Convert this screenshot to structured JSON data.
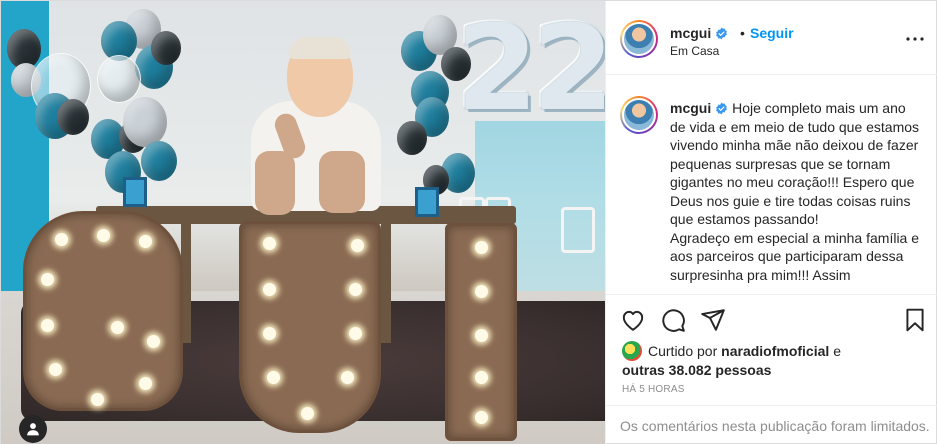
{
  "post": {
    "username": "mcgui",
    "follow_label": "Seguir",
    "separator": "•",
    "location": "Em Casa",
    "photo_number_text": "22",
    "caption": "Hoje completo mais um ano de vida e em meio de tudo que estamos vivendo minha mãe não deixou de fazer pequenas surpresas que se tornam gigantes no meu coração!!! Espero que Deus nos guie e tire todas coisas ruins que estamos passando!\nAgradeço em especial a minha família e aos parceiros que participaram dessa surpresinha pra mim!!! Assim",
    "likes_prefix": "Curtido por",
    "likes_user": "naradiofmoficial",
    "likes_and": "e",
    "likes_others": "outras 38.082 pessoas",
    "time_ago": "HÁ 5 HORAS",
    "comments_limited": "Os comentários nesta publicação foram limitados."
  },
  "icons": [
    "verified-badge-icon",
    "more-options-icon",
    "heart-icon",
    "comment-icon",
    "share-icon",
    "bookmark-icon",
    "tag-user-icon"
  ],
  "colors": {
    "accent": "#0095f6",
    "muted": "#8e8e8e",
    "border": "#efefef",
    "text": "#262626"
  }
}
